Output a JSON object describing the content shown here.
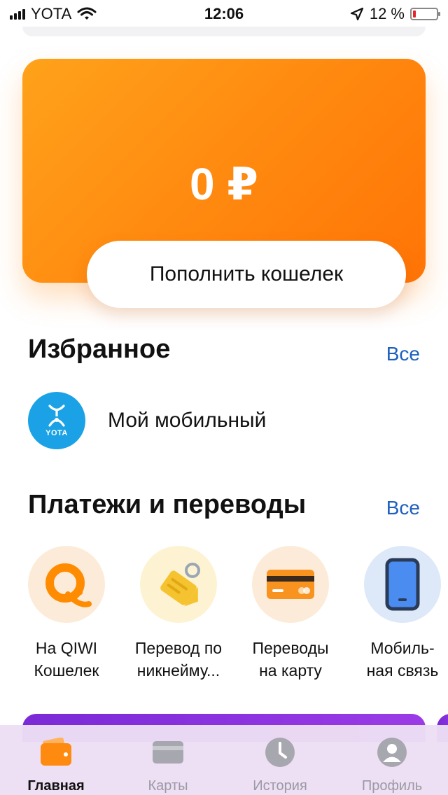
{
  "status_bar": {
    "carrier": "YOTA",
    "time": "12:06",
    "battery_text": "12 %",
    "battery_level": 0.12
  },
  "balance": {
    "amount": "0 ₽",
    "topup_label": "Пополнить кошелек",
    "card_color": "#ff8a10"
  },
  "favorites": {
    "title": "Избранное",
    "see_all": "Все",
    "items": [
      {
        "label": "Мой мобильный",
        "logo_text": "YOTA",
        "icon": "yota-logo-icon",
        "color": "#1ba2e6"
      }
    ]
  },
  "payments": {
    "title": "Платежи и переводы",
    "see_all": "Все",
    "tiles": [
      {
        "line1": "На QIWI",
        "line2": "Кошелек",
        "icon": "qiwi-icon",
        "bg": "#fdebd9"
      },
      {
        "line1": "Перевод по",
        "line2": "никнейму...",
        "icon": "price-tag-icon",
        "bg": "#fdf3d3"
      },
      {
        "line1": "Переводы",
        "line2": "на карту",
        "icon": "bank-card-icon",
        "bg": "#fdebd9"
      },
      {
        "line1": "Мобиль-",
        "line2": "ная связь",
        "icon": "smartphone-icon",
        "bg": "#dde9f8"
      }
    ]
  },
  "bottom_nav": {
    "items": [
      {
        "label": "Главная",
        "icon": "wallet-icon",
        "active": true
      },
      {
        "label": "Карты",
        "icon": "card-icon",
        "active": false
      },
      {
        "label": "История",
        "icon": "clock-icon",
        "active": false
      },
      {
        "label": "Профиль",
        "icon": "profile-icon",
        "active": false
      }
    ]
  },
  "colors": {
    "accent_orange": "#ff8a10",
    "link_blue": "#1d5fbf",
    "nav_inactive": "#9a9aa3"
  }
}
